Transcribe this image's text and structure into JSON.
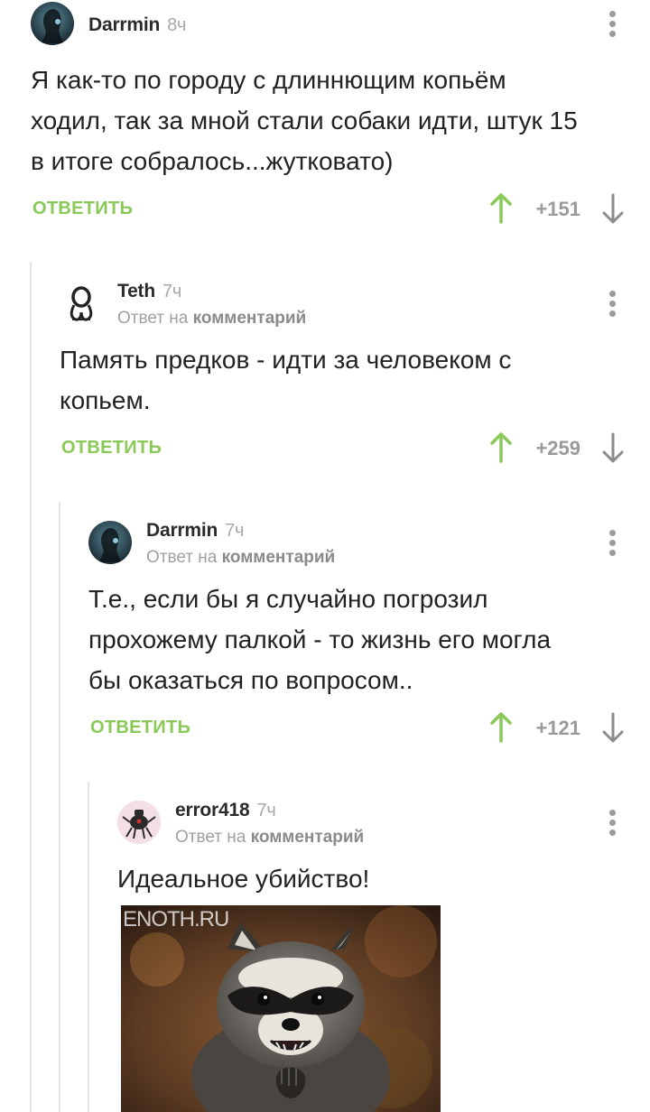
{
  "comments": [
    {
      "author": "Darrmin",
      "time": "8ч",
      "text_lines": [
        "Я как-то по городу с длиннющим копьём",
        "ходил, так за мной стали собаки идти, штук 15",
        "в итоге собралось...жутковато)"
      ],
      "reply_label": "ОТВЕТИТЬ",
      "score": "+151",
      "avatar_icon": "dark-ghost-avatar-icon"
    },
    {
      "author": "Teth",
      "time": "7ч",
      "reply_prefix": "Ответ на",
      "reply_target": "комментарий",
      "text_lines": [
        "Память предков - идти за человеком с",
        "копьем."
      ],
      "reply_label": "ОТВЕТИТЬ",
      "score": "+259",
      "avatar_icon": "knot-symbol-avatar-icon"
    },
    {
      "author": "Darrmin",
      "time": "7ч",
      "reply_prefix": "Ответ на",
      "reply_target": "комментарий",
      "text_lines": [
        "Т.е., если бы я случайно погрозил",
        "прохожему палкой - то жизнь его могла",
        "бы оказаться по вопросом.."
      ],
      "reply_label": "ОТВЕТИТЬ",
      "score": "+121",
      "avatar_icon": "dark-ghost-avatar-icon"
    },
    {
      "author": "error418",
      "time": "7ч",
      "reply_prefix": "Ответ на",
      "reply_target": "комментарий",
      "text_lines": [
        "Идеальное убийство!"
      ],
      "image_watermark": "ENOTH.RU",
      "image_subject": "raccoon-meme-image",
      "avatar_icon": "teapot-robot-avatar-icon"
    }
  ],
  "colors": {
    "accent_green": "#8ac858",
    "text": "#222222",
    "muted": "#a0a0a0",
    "thread_line": "#e6e6e6"
  }
}
